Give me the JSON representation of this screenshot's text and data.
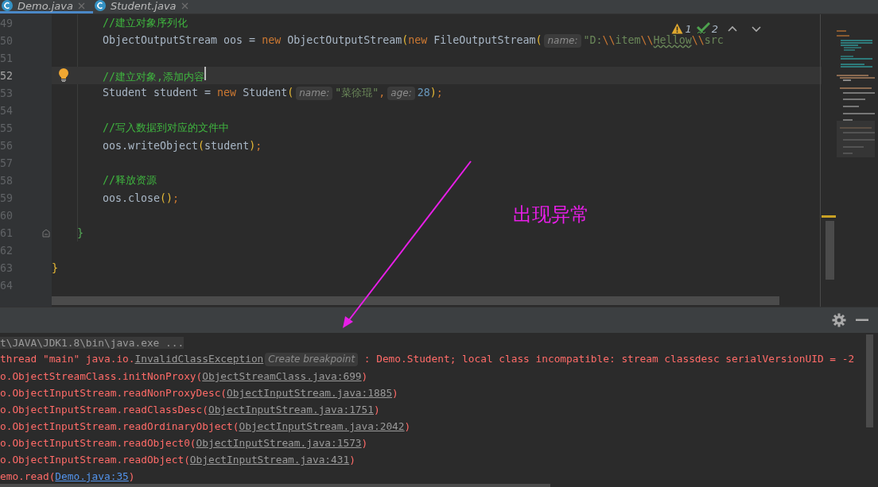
{
  "tabs": [
    {
      "label": "Demo.java",
      "selected": true,
      "closable": true
    },
    {
      "label": "Student.java",
      "selected": false,
      "closable": true
    }
  ],
  "editor": {
    "inspections": {
      "warnings": "1",
      "weak_warnings": "2"
    },
    "lines": [
      {
        "kind": "block",
        "children": [
          {
            "kind": "block",
            "children": [
              {
                "kind": "line",
                "number": "49",
                "selected": false,
                "tokens": [
                  {
                    "kind": "comment",
                    "text": "//建立对象序列化"
                  }
                ]
              },
              {
                "kind": "line",
                "number": "50",
                "selected": false,
                "tokens": [
                  {
                    "kind": "plain",
                    "text": "ObjectOutputStream oos = "
                  },
                  {
                    "kind": "keyword",
                    "text": "new"
                  },
                  {
                    "kind": "plain",
                    "text": " ObjectOutputStream"
                  },
                  {
                    "kind": "paren",
                    "text": "("
                  },
                  {
                    "kind": "keyword",
                    "text": "new"
                  },
                  {
                    "kind": "plain",
                    "text": " FileOutputStream"
                  },
                  {
                    "kind": "paren",
                    "text": "("
                  },
                  {
                    "kind": "hint",
                    "text": "name:"
                  },
                  {
                    "kind": "string",
                    "text": "\"D:"
                  },
                  {
                    "kind": "escape",
                    "text": "\\\\"
                  },
                  {
                    "kind": "string",
                    "text": "item"
                  },
                  {
                    "kind": "escape",
                    "text": "\\\\"
                  },
                  {
                    "kind": "typo",
                    "text": "Hellow"
                  },
                  {
                    "kind": "escape",
                    "text": "\\\\"
                  },
                  {
                    "kind": "string",
                    "text": "src"
                  }
                ]
              },
              {
                "kind": "line",
                "number": "51",
                "selected": false
              },
              {
                "kind": "line",
                "number": "52",
                "selected": true,
                "bulb": true,
                "tokens": [
                  {
                    "kind": "comment",
                    "text": "//建立对象,添加内容"
                  }
                ]
              },
              {
                "kind": "line",
                "number": "53",
                "selected": false,
                "tokens": [
                  {
                    "kind": "plain",
                    "text": "Student student = "
                  },
                  {
                    "kind": "keyword",
                    "text": "new"
                  },
                  {
                    "kind": "plain",
                    "text": " Student"
                  },
                  {
                    "kind": "paren",
                    "text": "("
                  },
                  {
                    "kind": "hint",
                    "text": "name:"
                  },
                  {
                    "kind": "string",
                    "text": "\"菜徐琨\""
                  },
                  {
                    "kind": "punct",
                    "text": ","
                  },
                  {
                    "kind": "hint",
                    "text": "age:"
                  },
                  {
                    "kind": "number",
                    "text": "28"
                  },
                  {
                    "kind": "paren",
                    "text": ")"
                  },
                  {
                    "kind": "punct",
                    "text": ";"
                  }
                ]
              },
              {
                "kind": "line",
                "number": "54",
                "selected": false
              },
              {
                "kind": "line",
                "number": "55",
                "selected": false,
                "tokens": [
                  {
                    "kind": "comment",
                    "text": "//写入数据到对应的文件中"
                  }
                ]
              },
              {
                "kind": "line",
                "number": "56",
                "selected": false,
                "tokens": [
                  {
                    "kind": "plain",
                    "text": "oos.writeObject"
                  },
                  {
                    "kind": "paren",
                    "text": "("
                  },
                  {
                    "kind": "plain",
                    "text": "student"
                  },
                  {
                    "kind": "paren",
                    "text": ")"
                  },
                  {
                    "kind": "punct",
                    "text": ";"
                  }
                ]
              },
              {
                "kind": "line",
                "number": "57",
                "selected": false
              },
              {
                "kind": "line",
                "number": "58",
                "selected": false,
                "tokens": [
                  {
                    "kind": "comment",
                    "text": "//释放资源"
                  }
                ]
              },
              {
                "kind": "line",
                "number": "59",
                "selected": false,
                "tokens": [
                  {
                    "kind": "plain",
                    "text": "oos.close"
                  },
                  {
                    "kind": "paren",
                    "text": "()"
                  },
                  {
                    "kind": "punct",
                    "text": ";"
                  }
                ]
              },
              {
                "kind": "line",
                "number": "60",
                "selected": false
              }
            ]
          },
          {
            "kind": "line",
            "number": "61",
            "selected": false,
            "fold": true,
            "tokens": [
              {
                "kind": "brace",
                "text": "}"
              }
            ]
          }
        ]
      },
      {
        "kind": "line",
        "number": "62",
        "selected": false
      },
      {
        "kind": "line",
        "number": "63",
        "selected": false,
        "tokens": [
          {
            "kind": "paren",
            "text": "}"
          }
        ]
      },
      {
        "kind": "line",
        "number": "64",
        "selected": false
      }
    ]
  },
  "annotation": {
    "text": "出现异常"
  },
  "console": {
    "lines": [
      {
        "tokens": [
          {
            "kind": "command",
            "text": "t\\JAVA\\JDK1.8\\bin\\java.exe ..."
          }
        ]
      },
      {
        "tokens": [
          {
            "kind": "error",
            "text": "thread \"main\" java.io."
          },
          {
            "kind": "file_link",
            "text": "InvalidClassException"
          },
          {
            "kind": "hint",
            "text": "Create breakpoint"
          },
          {
            "kind": "error",
            "text": " : Demo.Student; local class incompatible: stream classdesc serialVersionUID = -2"
          }
        ]
      },
      {
        "tokens": [
          {
            "kind": "error",
            "text": "o.ObjectStreamClass.initNonProxy("
          },
          {
            "kind": "file_link",
            "text": "ObjectStreamClass.java:699"
          },
          {
            "kind": "error",
            "text": ")"
          }
        ]
      },
      {
        "tokens": [
          {
            "kind": "error",
            "text": "o.ObjectInputStream.readNonProxyDesc("
          },
          {
            "kind": "file_link",
            "text": "ObjectInputStream.java:1885"
          },
          {
            "kind": "error",
            "text": ")"
          }
        ]
      },
      {
        "tokens": [
          {
            "kind": "error",
            "text": "o.ObjectInputStream.readClassDesc("
          },
          {
            "kind": "file_link",
            "text": "ObjectInputStream.java:1751"
          },
          {
            "kind": "error",
            "text": ")"
          }
        ]
      },
      {
        "tokens": [
          {
            "kind": "error",
            "text": "o.ObjectInputStream.readOrdinaryObject("
          },
          {
            "kind": "file_link",
            "text": "ObjectInputStream.java:2042"
          },
          {
            "kind": "error",
            "text": ")"
          }
        ]
      },
      {
        "tokens": [
          {
            "kind": "error",
            "text": "o.ObjectInputStream.readObject0("
          },
          {
            "kind": "file_link",
            "text": "ObjectInputStream.java:1573"
          },
          {
            "kind": "error",
            "text": ")"
          }
        ]
      },
      {
        "tokens": [
          {
            "kind": "error",
            "text": "o.ObjectInputStream.readObject("
          },
          {
            "kind": "file_link",
            "text": "ObjectInputStream.java:431"
          },
          {
            "kind": "error",
            "text": ")"
          }
        ]
      },
      {
        "tokens": [
          {
            "kind": "error",
            "text": "emo.read("
          },
          {
            "kind": "source_link",
            "text": "Demo.java:35"
          },
          {
            "kind": "error",
            "text": ")"
          }
        ]
      }
    ]
  }
}
